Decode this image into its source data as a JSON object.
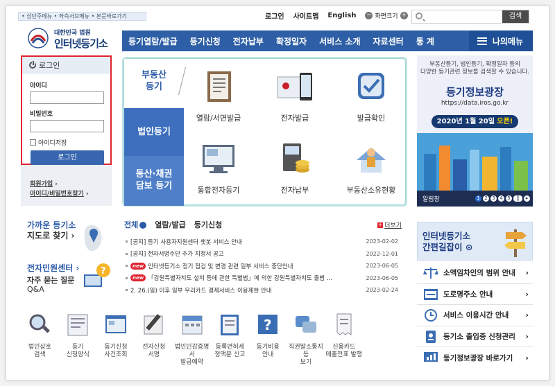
{
  "skip_links": "• 상단주메뉴  • 좌측서브메뉴  • 본문바로가기",
  "util": {
    "login": "로그인",
    "sitemap": "사이트맵",
    "english": "English",
    "font_size": "화면크기",
    "minus": "−",
    "plus": "+"
  },
  "search": {
    "placeholder": "",
    "button": "검색"
  },
  "logo": {
    "line1": "대한민국 법원",
    "line2": "인터넷등기소"
  },
  "gnb": {
    "items": [
      "등기열람/발급",
      "등기신청",
      "전자납부",
      "확정일자",
      "서비스 소개",
      "자료센터",
      "통 계"
    ],
    "my_menu": "나의메뉴"
  },
  "login": {
    "title": "로그인",
    "id_label": "아이디",
    "pw_label": "비밀번호",
    "save_id": "아이디저장",
    "button": "로그인",
    "join": "회원가입",
    "find": "아이디/비밀번호찾기"
  },
  "service": {
    "cat_a": [
      "부동산",
      "등기"
    ],
    "cat_b": "법인등기",
    "cat_c": [
      "동산·채권",
      "담보 등기"
    ],
    "items": [
      "열람/서면발급",
      "전자발급",
      "발급확인",
      "통합전자등기",
      "전자납부",
      "부동산소유현황"
    ]
  },
  "banner": {
    "desc": "부동산등기, 법인등기, 확정일자 등의\n다양한 등기관련 정보를 검색할 수 있습니다.",
    "title": "등기정보광장",
    "url": "https://data.iros.go.kr",
    "date": "2020년 1월 20일 ",
    "open": "오픈!",
    "foot": "알림창",
    "pages": [
      "1",
      "2",
      "3",
      "4",
      "5"
    ]
  },
  "near": {
    "t1": "가까운 등기소",
    "t2": "지도로 찾기 ›"
  },
  "civil": {
    "c1": "전자민원센터 ›",
    "c2": "자주 묻는 질문",
    "c3": "Q&A"
  },
  "news": {
    "tabs": [
      "전체",
      "열람/발급",
      "등기신청"
    ],
    "more": "더보기",
    "new_label": "new",
    "rows": [
      {
        "new": false,
        "text": "[공지] 등기 사용자지원센터 챗봇 서비스 안내",
        "date": "2023-02-02"
      },
      {
        "new": false,
        "text": "[공지] 전자서명수단 추가 지정서 공고",
        "date": "2022-12-01"
      },
      {
        "new": true,
        "text": "인터넷등기소 정기 점검 및 변경 관련 일부 서비스 중단안내",
        "date": "2023-06-05"
      },
      {
        "new": true,
        "text": "「강원특별자치도 설치 등에 관한 특별법」에 의한 강원특별자치도 출범 …",
        "date": "2023-06-05"
      },
      {
        "new": false,
        "text": "2. 26.(일) 이후 일부 우리카드 결제서비스 이용제한 안내",
        "date": "2023-02-24"
      }
    ]
  },
  "quick": [
    {
      "l1": "법인상호",
      "l2": "검색"
    },
    {
      "l1": "등기",
      "l2": "신청양식"
    },
    {
      "l1": "등기신청",
      "l2": "사건조회"
    },
    {
      "l1": "전자신청",
      "l2": "서명"
    },
    {
      "l1": "법인인감증명서",
      "l2": "발급예약"
    },
    {
      "l1": "등록면허세",
      "l2": "정액분 신고"
    },
    {
      "l1": "등기비용",
      "l2": "안내"
    },
    {
      "l1": "직권말소통지등",
      "l2": "보기"
    },
    {
      "l1": "신용카드",
      "l2": "매출전표 발행"
    }
  ],
  "right_banner": {
    "l1": "인터넷등기소",
    "l2": "간편길잡이"
  },
  "right_links": [
    "소액임차인의 범위 안내",
    "도로명주소 안내",
    "서비스 이용시간 안내",
    "등기소 출입증 신청관리",
    "등기정보광장 바로가기"
  ]
}
